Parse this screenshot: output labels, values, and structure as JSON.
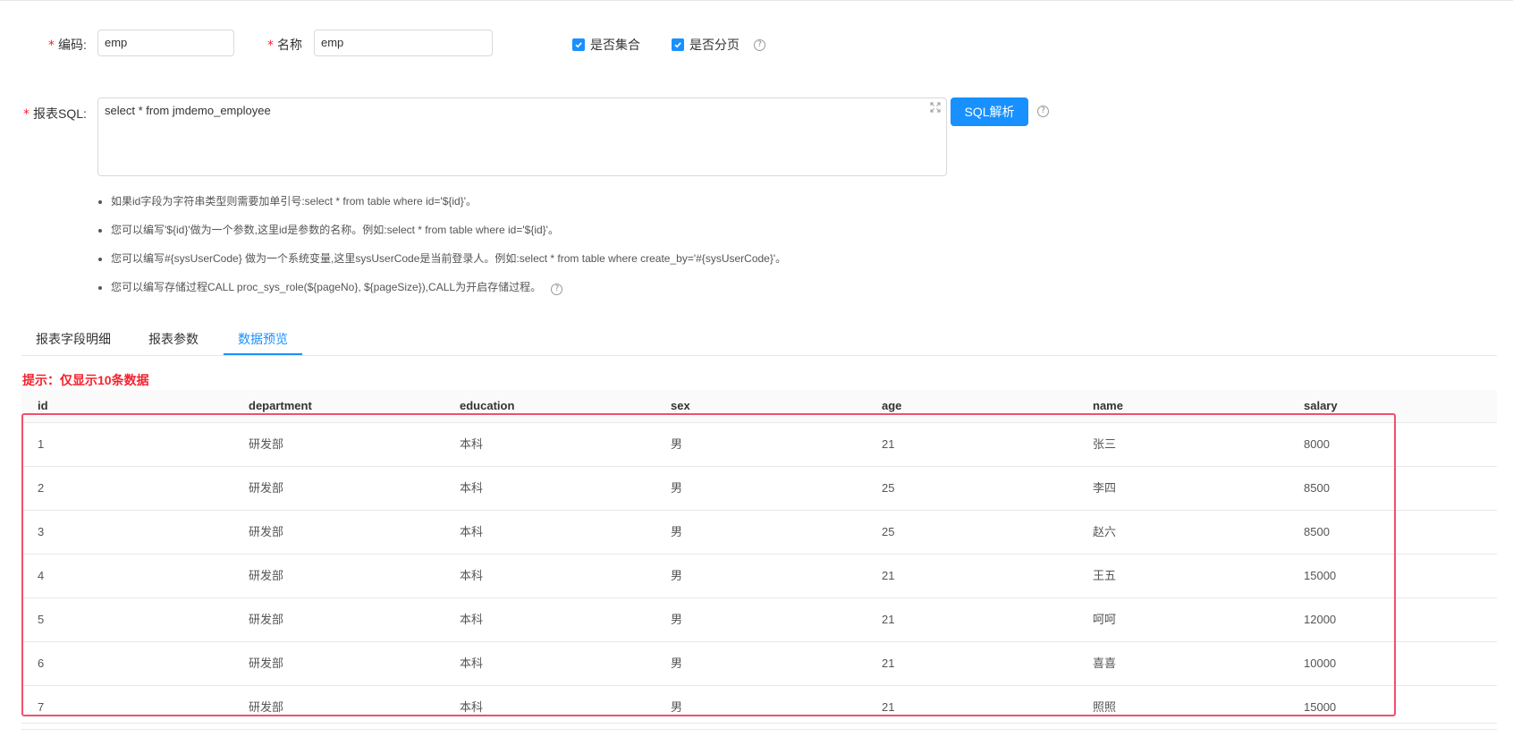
{
  "form": {
    "code": {
      "label": "编码:",
      "value": "emp"
    },
    "name": {
      "label": "名称",
      "value": "emp"
    },
    "is_collection": {
      "label": "是否集合",
      "checked": true
    },
    "is_paged": {
      "label": "是否分页",
      "checked": true
    },
    "sql": {
      "label": "报表SQL:",
      "value": "select * from jmdemo_employee"
    },
    "parse_button": "SQL解析",
    "help_glyph": "?"
  },
  "tips": [
    "如果id字段为字符串类型则需要加单引号:select * from table where id='${id}'。",
    "您可以编写'${id}'做为一个参数,这里id是参数的名称。例如:select * from table where id='${id}'。",
    "您可以编写#{sysUserCode} 做为一个系统变量,这里sysUserCode是当前登录人。例如:select * from table where create_by='#{sysUserCode}'。",
    "您可以编写存储过程CALL proc_sys_role(${pageNo}, ${pageSize}),CALL为开启存储过程。"
  ],
  "tabs": [
    "报表字段明细",
    "报表参数",
    "数据预览"
  ],
  "active_tab": 2,
  "notice": "提示：仅显示10条数据",
  "table": {
    "columns": [
      "id",
      "department",
      "education",
      "sex",
      "age",
      "name",
      "salary"
    ],
    "rows": [
      [
        "1",
        "研发部",
        "本科",
        "男",
        "21",
        "张三",
        "8000"
      ],
      [
        "2",
        "研发部",
        "本科",
        "男",
        "25",
        "李四",
        "8500"
      ],
      [
        "3",
        "研发部",
        "本科",
        "男",
        "25",
        "赵六",
        "8500"
      ],
      [
        "4",
        "研发部",
        "本科",
        "男",
        "21",
        "王五",
        "15000"
      ],
      [
        "5",
        "研发部",
        "本科",
        "男",
        "21",
        "呵呵",
        "12000"
      ],
      [
        "6",
        "研发部",
        "本科",
        "男",
        "21",
        "喜喜",
        "10000"
      ],
      [
        "7",
        "研发部",
        "本科",
        "男",
        "21",
        "照照",
        "15000"
      ]
    ]
  },
  "colors": {
    "primary": "#1890ff",
    "required": "#f5222d",
    "highlight": "#f0506e"
  }
}
